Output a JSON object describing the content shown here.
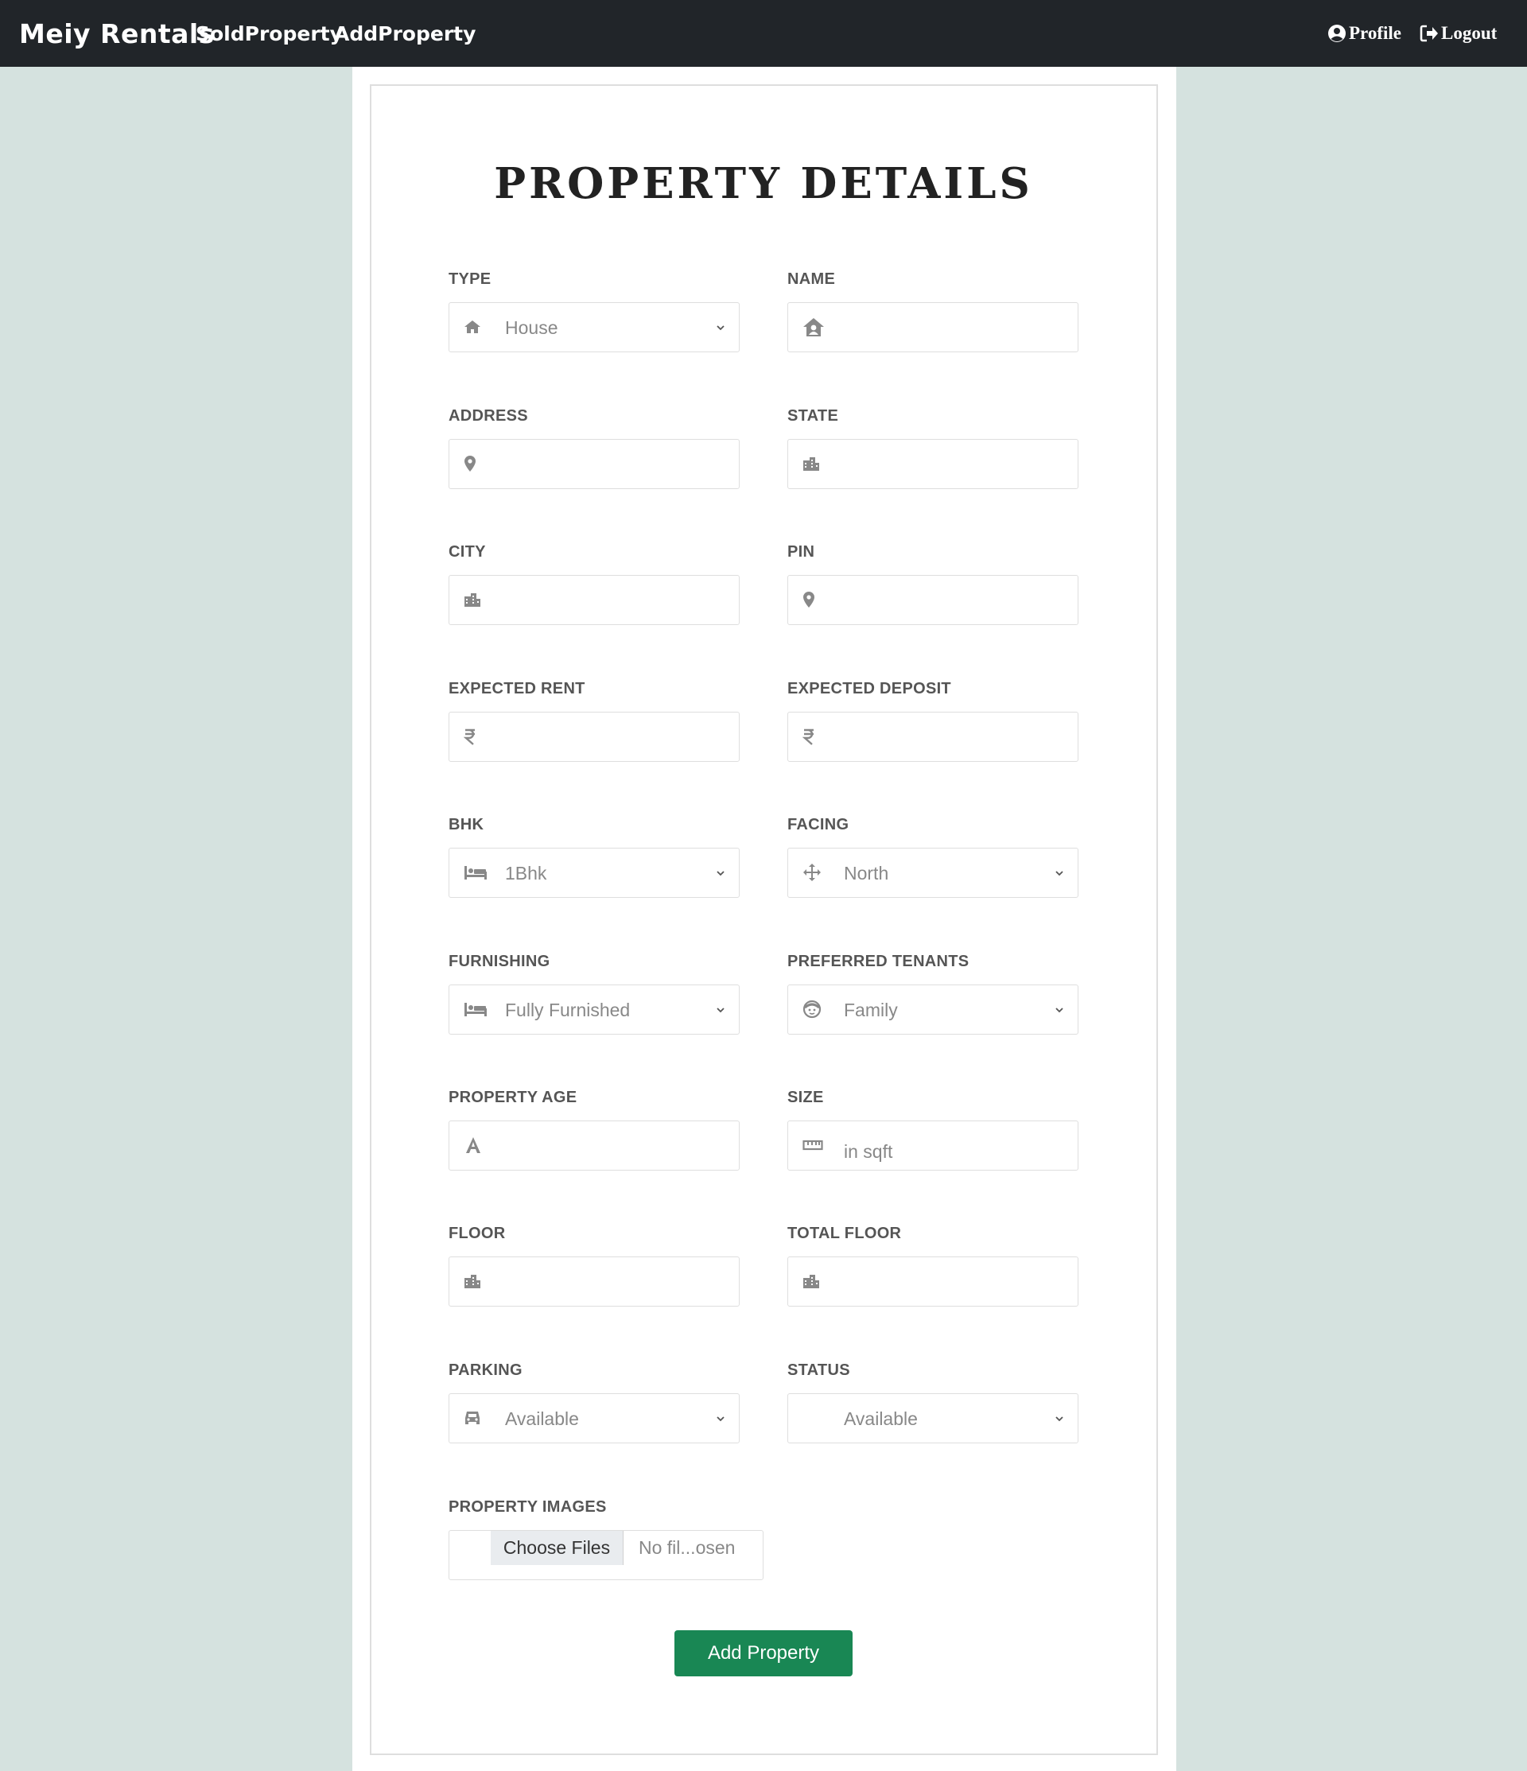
{
  "nav": {
    "brand": "Meiy Rentals",
    "links": [
      "SoldProperty",
      "AddProperty"
    ],
    "profile": "Profile",
    "logout": "Logout"
  },
  "form": {
    "title": "PROPERTY DETAILS",
    "fields": {
      "type": {
        "label": "TYPE",
        "value": "House",
        "icon": "home-icon"
      },
      "name": {
        "label": "NAME",
        "value": "",
        "icon": "house-user-icon"
      },
      "address": {
        "label": "ADDRESS",
        "value": "",
        "icon": "map-pin-icon"
      },
      "state": {
        "label": "STATE",
        "value": "",
        "icon": "city-icon"
      },
      "city": {
        "label": "CITY",
        "value": "",
        "icon": "city-icon"
      },
      "pin": {
        "label": "PIN",
        "value": "",
        "icon": "map-pin-icon"
      },
      "expected_rent": {
        "label": "EXPECTED RENT",
        "value": "",
        "icon": "rupee-icon"
      },
      "expected_deposit": {
        "label": "EXPECTED DEPOSIT",
        "value": "",
        "icon": "rupee-icon"
      },
      "bhk": {
        "label": "BHK",
        "value": "1Bhk",
        "icon": "bed-icon"
      },
      "facing": {
        "label": "FACING",
        "value": "North",
        "icon": "arrows-icon"
      },
      "furnishing": {
        "label": "FURNISHING",
        "value": "Fully Furnished",
        "icon": "bed-icon"
      },
      "preferred_tenants": {
        "label": "PREFERRED TENANTS",
        "value": "Family",
        "icon": "face-icon"
      },
      "property_age": {
        "label": "PROPERTY AGE",
        "value": "",
        "icon": "letter-a-icon"
      },
      "size": {
        "label": "SIZE",
        "placeholder": "in sqft",
        "icon": "ruler-icon"
      },
      "floor": {
        "label": "FLOOR",
        "value": "",
        "icon": "city-icon"
      },
      "total_floor": {
        "label": "TOTAL FLOOR",
        "value": "",
        "icon": "city-icon"
      },
      "parking": {
        "label": "PARKING",
        "value": "Available",
        "icon": "car-icon"
      },
      "status": {
        "label": "STATUS",
        "value": "Available"
      }
    },
    "images": {
      "label": "PROPERTY IMAGES",
      "button": "Choose Files",
      "file_name": "No fil...osen"
    },
    "submit_label": "Add Property"
  },
  "colors": {
    "navbar": "#212529",
    "background": "#d5e2df",
    "submit": "#198754",
    "icon": "#888888"
  }
}
